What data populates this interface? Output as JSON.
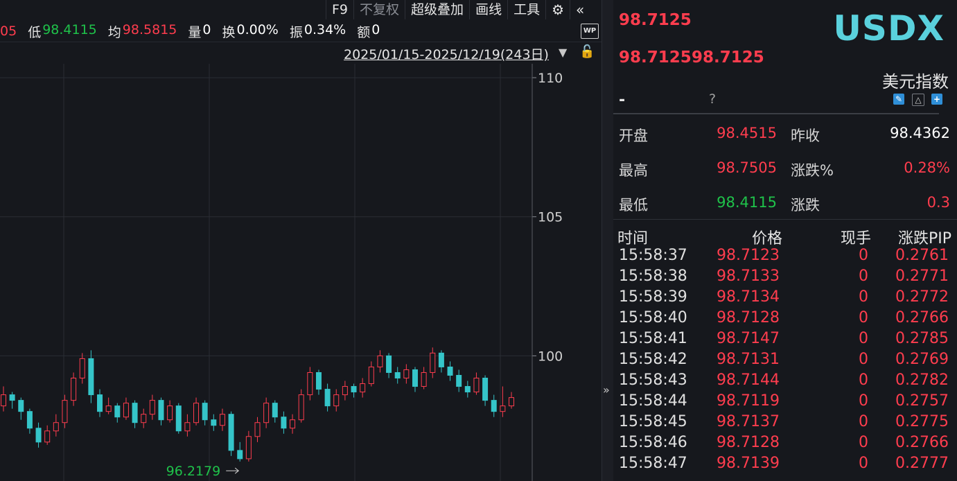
{
  "toolbar": {
    "f9": "F9",
    "fuquan": "不复权",
    "overlay": "超级叠加",
    "draw": "画线",
    "tools": "工具"
  },
  "infobar": {
    "high_cut": "05",
    "low_label": "低",
    "low_value": "98.4115",
    "avg_label": "均",
    "avg_value": "98.5815",
    "vol_label": "量",
    "vol_value": "0",
    "turnover_label": "换",
    "turnover_value": "0.00%",
    "amp_label": "振",
    "amp_value": "0.34%",
    "amount_label": "额",
    "amount_value": "0"
  },
  "wp_label": "WP",
  "date_range": "2025/01/15-2025/12/19(243日)",
  "chart_data": {
    "type": "candlestick",
    "y_ticks": [
      "110",
      "105",
      "100"
    ],
    "ylim": [
      95.5,
      110.5
    ],
    "min_annotation": {
      "label": "96.2179",
      "value": 96.2179
    },
    "up_color": "#ff3d4e",
    "down_color": "#35c5c9",
    "candles": [
      [
        98.2,
        98.6,
        98.9,
        98.0
      ],
      [
        98.6,
        98.4,
        98.7,
        98.1
      ],
      [
        98.4,
        98.0,
        98.5,
        97.7
      ],
      [
        98.0,
        97.4,
        98.1,
        97.2
      ],
      [
        97.4,
        96.9,
        97.6,
        96.7
      ],
      [
        96.9,
        97.3,
        97.5,
        96.8
      ],
      [
        97.3,
        97.6,
        97.9,
        97.1
      ],
      [
        97.6,
        98.4,
        98.6,
        97.4
      ],
      [
        98.4,
        99.2,
        99.4,
        98.2
      ],
      [
        99.2,
        99.9,
        100.1,
        99.0
      ],
      [
        99.9,
        98.6,
        100.2,
        98.3
      ],
      [
        98.6,
        98.0,
        98.8,
        97.8
      ],
      [
        98.0,
        98.2,
        98.5,
        97.9
      ],
      [
        98.2,
        97.8,
        98.3,
        97.6
      ],
      [
        97.8,
        98.3,
        98.5,
        97.7
      ],
      [
        98.3,
        97.6,
        98.4,
        97.4
      ],
      [
        97.6,
        97.9,
        98.1,
        97.4
      ],
      [
        97.9,
        98.4,
        98.6,
        97.7
      ],
      [
        98.4,
        97.7,
        98.5,
        97.5
      ],
      [
        97.7,
        98.2,
        98.4,
        97.6
      ],
      [
        98.2,
        97.3,
        98.3,
        97.2
      ],
      [
        97.3,
        97.6,
        97.9,
        97.1
      ],
      [
        97.6,
        98.3,
        98.5,
        97.5
      ],
      [
        98.3,
        97.7,
        98.4,
        97.5
      ],
      [
        97.7,
        97.5,
        97.9,
        97.3
      ],
      [
        97.5,
        97.9,
        98.1,
        97.3
      ],
      [
        97.9,
        96.6,
        98.0,
        96.4
      ],
      [
        96.6,
        96.3,
        96.9,
        96.2
      ],
      [
        96.3,
        97.1,
        97.3,
        96.2
      ],
      [
        97.1,
        97.6,
        97.8,
        96.9
      ],
      [
        97.6,
        98.3,
        98.5,
        97.4
      ],
      [
        98.3,
        97.8,
        98.4,
        97.6
      ],
      [
        97.8,
        97.4,
        98.0,
        97.2
      ],
      [
        97.4,
        97.7,
        97.9,
        97.2
      ],
      [
        97.7,
        98.6,
        98.8,
        97.6
      ],
      [
        98.6,
        99.4,
        99.6,
        98.4
      ],
      [
        99.4,
        98.8,
        99.5,
        98.6
      ],
      [
        98.8,
        98.2,
        99.0,
        98.0
      ],
      [
        98.2,
        98.6,
        98.8,
        98.0
      ],
      [
        98.6,
        98.9,
        99.1,
        98.4
      ],
      [
        98.9,
        98.7,
        99.0,
        98.5
      ],
      [
        98.7,
        99.0,
        99.2,
        98.5
      ],
      [
        99.0,
        99.6,
        99.8,
        98.9
      ],
      [
        99.6,
        100.0,
        100.2,
        99.4
      ],
      [
        100.0,
        99.4,
        100.1,
        99.2
      ],
      [
        99.4,
        99.2,
        99.6,
        99.0
      ],
      [
        99.2,
        99.5,
        99.7,
        99.0
      ],
      [
        99.5,
        98.9,
        99.6,
        98.7
      ],
      [
        98.9,
        99.4,
        99.6,
        98.8
      ],
      [
        99.4,
        100.1,
        100.3,
        99.2
      ],
      [
        100.1,
        99.6,
        100.2,
        99.4
      ],
      [
        99.6,
        99.3,
        99.8,
        99.1
      ],
      [
        99.3,
        98.9,
        99.5,
        98.7
      ],
      [
        98.9,
        98.7,
        99.1,
        98.5
      ],
      [
        98.7,
        99.2,
        99.4,
        98.6
      ],
      [
        99.2,
        98.4,
        99.3,
        98.2
      ],
      [
        98.4,
        98.0,
        98.6,
        97.8
      ],
      [
        98.0,
        98.2,
        98.9,
        97.8
      ],
      [
        98.2,
        98.5,
        98.7,
        98.1
      ]
    ]
  },
  "panel": {
    "last_price": "98.7125",
    "bid": "98.7125",
    "ask": "98.7125",
    "ticker": "USDX",
    "name_cn": "美元指数",
    "dash": "-",
    "question": "?",
    "quote": [
      {
        "l1": "开盘",
        "v1": "98.4515",
        "c1": "red",
        "l2": "昨收",
        "v2": "98.4362",
        "c2": "white"
      },
      {
        "l1": "最高",
        "v1": "98.7505",
        "c1": "red",
        "l2": "涨跌%",
        "v2": "0.28%",
        "c2": "red"
      },
      {
        "l1": "最低",
        "v1": "98.4115",
        "c1": "green",
        "l2": "涨跌",
        "v2": "0.3",
        "c2": "red"
      }
    ],
    "ticks_header": {
      "time": "时间",
      "price": "价格",
      "vol": "现手",
      "pip": "涨跌PIP"
    },
    "ticks": [
      {
        "time": "15:58:37",
        "price": "98.7123",
        "vol": "0",
        "pip": "0.2761"
      },
      {
        "time": "15:58:38",
        "price": "98.7133",
        "vol": "0",
        "pip": "0.2771"
      },
      {
        "time": "15:58:39",
        "price": "98.7134",
        "vol": "0",
        "pip": "0.2772"
      },
      {
        "time": "15:58:40",
        "price": "98.7128",
        "vol": "0",
        "pip": "0.2766"
      },
      {
        "time": "15:58:41",
        "price": "98.7147",
        "vol": "0",
        "pip": "0.2785"
      },
      {
        "time": "15:58:42",
        "price": "98.7131",
        "vol": "0",
        "pip": "0.2769"
      },
      {
        "time": "15:58:43",
        "price": "98.7144",
        "vol": "0",
        "pip": "0.2782"
      },
      {
        "time": "15:58:44",
        "price": "98.7119",
        "vol": "0",
        "pip": "0.2757"
      },
      {
        "time": "15:58:45",
        "price": "98.7137",
        "vol": "0",
        "pip": "0.2775"
      },
      {
        "time": "15:58:46",
        "price": "98.7128",
        "vol": "0",
        "pip": "0.2766"
      },
      {
        "time": "15:58:47",
        "price": "98.7139",
        "vol": "0",
        "pip": "0.2777"
      }
    ]
  }
}
